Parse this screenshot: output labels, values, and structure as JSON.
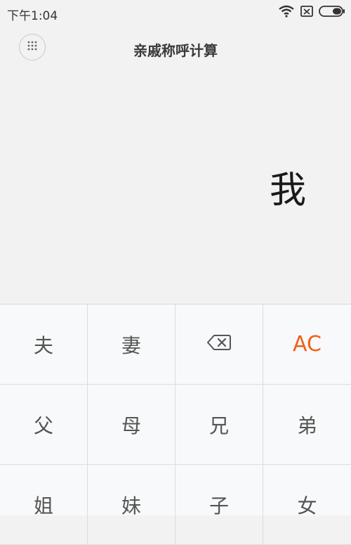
{
  "status_bar": {
    "time": "下午1:04"
  },
  "header": {
    "title": "亲戚称呼计算"
  },
  "display": {
    "text": "我"
  },
  "keypad": {
    "keys": [
      {
        "label": "夫",
        "name": "key-husband"
      },
      {
        "label": "妻",
        "name": "key-wife"
      },
      {
        "label": "",
        "name": "backspace-button"
      },
      {
        "label": "AC",
        "name": "clear-button"
      },
      {
        "label": "父",
        "name": "key-father"
      },
      {
        "label": "母",
        "name": "key-mother"
      },
      {
        "label": "兄",
        "name": "key-elder-brother"
      },
      {
        "label": "弟",
        "name": "key-younger-brother"
      },
      {
        "label": "姐",
        "name": "key-elder-sister"
      },
      {
        "label": "妹",
        "name": "key-younger-sister"
      },
      {
        "label": "子",
        "name": "key-son"
      },
      {
        "label": "女",
        "name": "key-daughter"
      }
    ]
  },
  "colors": {
    "accent": "#f06018",
    "background": "#f1f2f1",
    "keypad": "#f8f9fa"
  }
}
